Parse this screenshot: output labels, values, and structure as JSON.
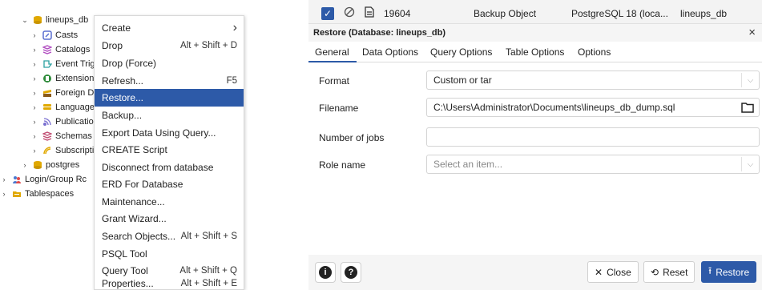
{
  "tree": {
    "items": [
      {
        "label": "lineups_db",
        "chevron": "⌄",
        "icon": "database-icon",
        "color": "#e0a800"
      },
      {
        "label": "Casts",
        "chevron": ">",
        "icon": "cast-icon",
        "color": "#5a6fd0"
      },
      {
        "label": "Catalogs",
        "chevron": ">",
        "icon": "catalog-icon",
        "color": "#b04ac0"
      },
      {
        "label": "Event Trig",
        "chevron": ">",
        "icon": "event-trigger-icon",
        "color": "#2aa0a0"
      },
      {
        "label": "Extension",
        "chevron": ">",
        "icon": "extension-icon",
        "color": "#2e8b3a"
      },
      {
        "label": "Foreign Da",
        "chevron": ">",
        "icon": "foreign-data-icon",
        "color": "#e0a800"
      },
      {
        "label": "Language",
        "chevron": ">",
        "icon": "language-icon",
        "color": "#e0a800"
      },
      {
        "label": "Publicatio",
        "chevron": ">",
        "icon": "publication-icon",
        "color": "#7a6fd0"
      },
      {
        "label": "Schemas",
        "chevron": ">",
        "icon": "schema-icon",
        "color": "#c04a70"
      },
      {
        "label": "Subscripti",
        "chevron": ">",
        "icon": "subscription-icon",
        "color": "#e0a800"
      },
      {
        "label": "postgres",
        "chevron": ">",
        "icon": "database-icon",
        "color": "#e0a800"
      },
      {
        "label": "Login/Group Rc",
        "chevron": ">",
        "icon": "login-role-icon",
        "color": "#4a7ad0"
      },
      {
        "label": "Tablespaces",
        "chevron": ">",
        "icon": "tablespace-icon",
        "color": "#e0a800"
      }
    ]
  },
  "context_menu": {
    "items": [
      {
        "label": "Create",
        "shortcut": "›"
      },
      {
        "label": "Drop",
        "shortcut": "Alt + Shift + D"
      },
      {
        "label": "Drop (Force)",
        "shortcut": ""
      },
      {
        "label": "Refresh...",
        "shortcut": "F5"
      },
      {
        "label": "Restore...",
        "shortcut": "",
        "selected": true
      },
      {
        "label": "Backup...",
        "shortcut": ""
      },
      {
        "label": "Export Data Using Query...",
        "shortcut": ""
      },
      {
        "label": "CREATE Script",
        "shortcut": ""
      },
      {
        "label": "Disconnect from database",
        "shortcut": ""
      },
      {
        "label": "ERD For Database",
        "shortcut": ""
      },
      {
        "label": "Maintenance...",
        "shortcut": ""
      },
      {
        "label": "Grant Wizard...",
        "shortcut": ""
      },
      {
        "label": "Search Objects...",
        "shortcut": "Alt + Shift + S"
      },
      {
        "label": "PSQL Tool",
        "shortcut": ""
      },
      {
        "label": "Query Tool",
        "shortcut": "Alt + Shift + Q"
      },
      {
        "label": "Properties...",
        "shortcut": "Alt + Shift + E"
      }
    ]
  },
  "process_row": {
    "pid": "19604",
    "type": "Backup Object",
    "server": "PostgreSQL 18 (loca...",
    "database": "lineups_db"
  },
  "dialog": {
    "title": "Restore (Database: lineups_db)",
    "close_glyph": "×",
    "tabs": [
      "General",
      "Data Options",
      "Query Options",
      "Table Options",
      "Options"
    ],
    "fields": {
      "format_label": "Format",
      "format_value": "Custom or tar",
      "filename_label": "Filename",
      "filename_value": "C:\\Users\\Administrator\\Documents\\lineups_db_dump.sql",
      "jobs_label": "Number of jobs",
      "jobs_value": "",
      "role_label": "Role name",
      "role_placeholder": "Select an item..."
    },
    "footer": {
      "info_glyph": "i",
      "help_glyph": "?",
      "close_label": "Close",
      "reset_label": "Reset",
      "restore_label": "Restore"
    }
  },
  "colors": {
    "accent": "#2d5aa8"
  }
}
